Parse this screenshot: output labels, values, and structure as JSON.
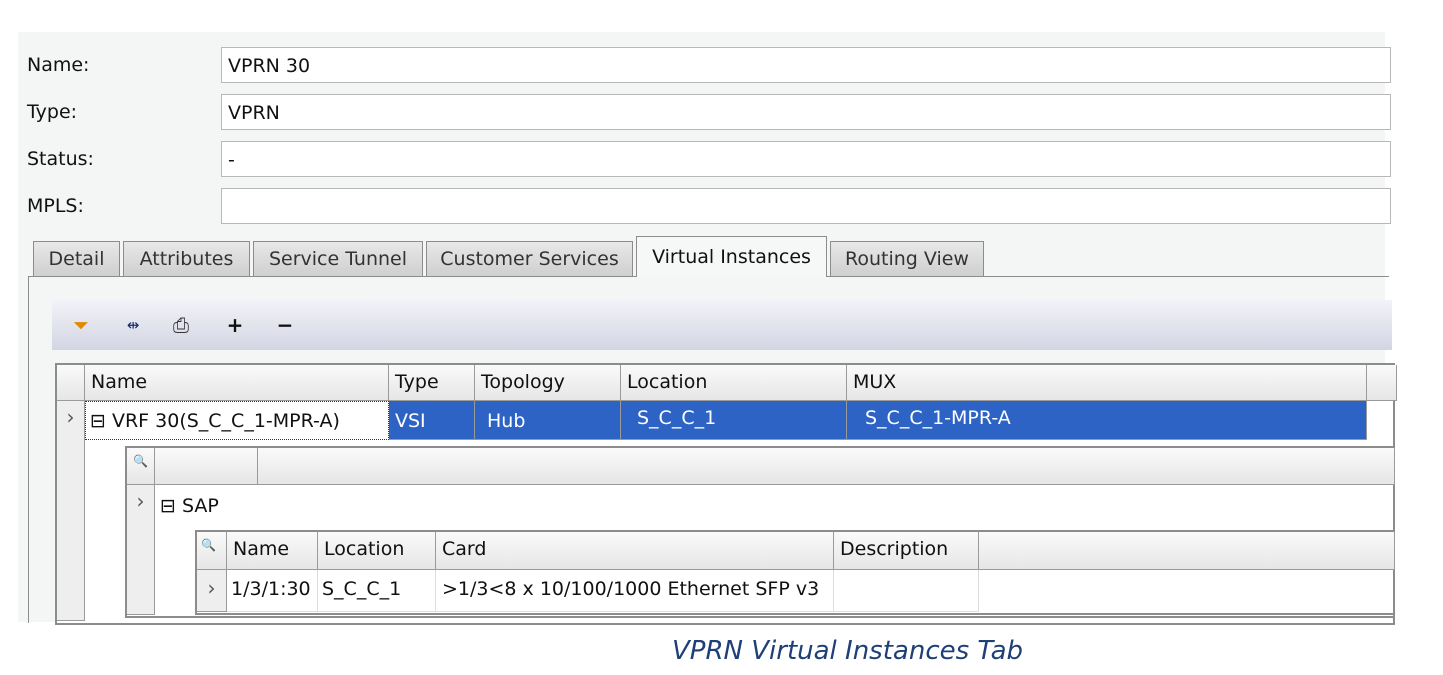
{
  "form": {
    "name_label": "Name:",
    "name_value": "VPRN 30",
    "type_label": "Type:",
    "type_value": "VPRN",
    "status_label": "Status:",
    "status_value": "-",
    "mpls_label": "MPLS:",
    "mpls_value": ""
  },
  "tabs": [
    {
      "label": "Detail"
    },
    {
      "label": "Attributes"
    },
    {
      "label": "Service Tunnel"
    },
    {
      "label": "Customer Services"
    },
    {
      "label": "Virtual Instances",
      "active": true
    },
    {
      "label": "Routing View"
    }
  ],
  "toolbar": {
    "icons": [
      "filter-icon",
      "column-fit-icon",
      "print-icon"
    ],
    "add": "+",
    "remove": "−"
  },
  "grid": {
    "columns": [
      "Name",
      "Type",
      "Topology",
      "Location",
      "MUX"
    ],
    "row": {
      "expander": "⊟",
      "name": "VRF 30(S_C_C_1-MPR-A)",
      "type": "VSI",
      "topology": "Hub",
      "location": "S_C_C_1",
      "mux": "S_C_C_1-MPR-A"
    },
    "selected_color": "#2d63c4"
  },
  "subgrid": {
    "group": "SAP",
    "expander": "⊟",
    "columns": [
      "Name",
      "Location",
      "Card",
      "Description"
    ],
    "rows": [
      {
        "name": "1/3/1:30",
        "location": "S_C_C_1",
        "card": ">1/3<8 x 10/100/1000 Ethernet SFP v3",
        "description": ""
      }
    ]
  },
  "caption": "VPRN Virtual Instances Tab"
}
